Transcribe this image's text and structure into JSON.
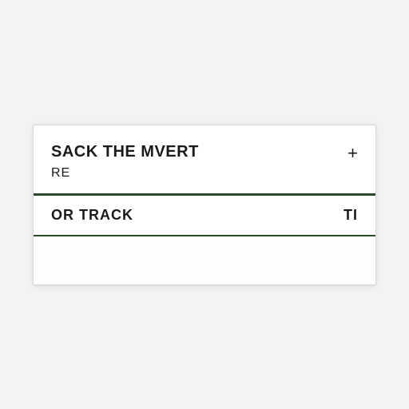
{
  "header": {
    "title_line1": "SACK THE MVERT",
    "title_line2": "RE",
    "add_icon_glyph": "+"
  },
  "row": {
    "label": "OR  TRACK",
    "trailing": "TI"
  }
}
